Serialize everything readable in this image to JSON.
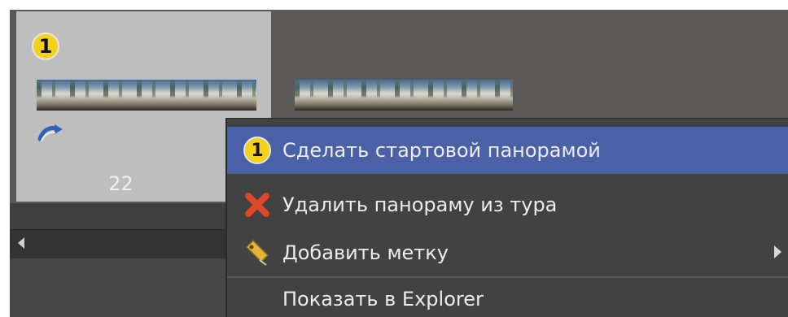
{
  "thumbnails": {
    "selected_badge": "1",
    "selected_number": "22",
    "items": [
      {
        "name": "panorama-thumbnail-1"
      },
      {
        "name": "panorama-thumbnail-2"
      }
    ]
  },
  "icons": {
    "start_badge": "start-number-badge-icon",
    "rotate": "rotate-icon",
    "delete": "red-x-icon",
    "tag": "tag-icon",
    "submenu": "chevron-right-icon",
    "scroll_left": "scroll-left-arrow-icon"
  },
  "context_menu": {
    "items": [
      {
        "label": "Сделать стартовой панорамой",
        "icon": "start-number-badge-icon",
        "badge": "1",
        "highlighted": true
      },
      {
        "label": "Удалить панораму из тура",
        "icon": "red-x-icon"
      },
      {
        "label": "Добавить метку",
        "icon": "tag-icon",
        "has_submenu": true
      },
      {
        "label": "Показать в Explorer"
      }
    ]
  },
  "colors": {
    "highlight": "#4a61a8",
    "badge_yellow": "#f2d21a",
    "delete_red": "#e0482a"
  }
}
